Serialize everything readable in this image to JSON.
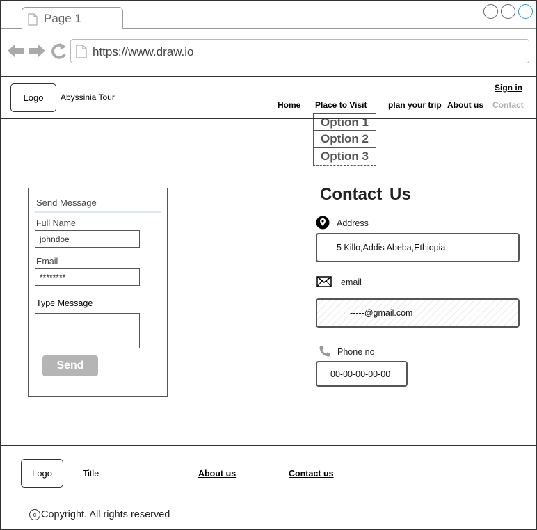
{
  "browser": {
    "tab_title": "Page 1",
    "url": "https://www.draw.io",
    "icons": [
      "back-arrow-icon",
      "forward-arrow-icon",
      "reload-icon",
      "page-icon"
    ]
  },
  "header": {
    "logo": "Logo",
    "brand": "Abyssinia Tour",
    "sign_in": "Sign in",
    "nav": {
      "home": "Home",
      "places": "Place to Visit",
      "plan": "plan your trip",
      "about": "About us",
      "contact": "Contact"
    },
    "dropdown": [
      "Option 1",
      "Option 2",
      "Option 3"
    ]
  },
  "form": {
    "title": "Send Message",
    "full_name_label": "Full Name",
    "full_name_value": "johndoe",
    "email_label": "Email",
    "email_value": "********",
    "message_label": "Type Message",
    "message_value": "",
    "send_label": "Send"
  },
  "contact": {
    "title": "Contact  Us",
    "address_label": "Address",
    "address_value": "5 Killo,Addis Abeba,Ethiopia",
    "email_label": "email",
    "email_value": "-----@gmail.com",
    "phone_label": "Phone no",
    "phone_value": "00-00-00-00-00"
  },
  "footer": {
    "logo": "Logo",
    "title": "Title",
    "about": "About us",
    "contact": "Contact us",
    "copyright": "Copyright. All rights reserved",
    "copyright_symbol": "c"
  },
  "colors": {
    "accent_blue": "#1ba1e2",
    "muted_link": "#b0b0b0",
    "button_gray": "#b5b5b5",
    "panel_rule": "#dbe8fa"
  }
}
